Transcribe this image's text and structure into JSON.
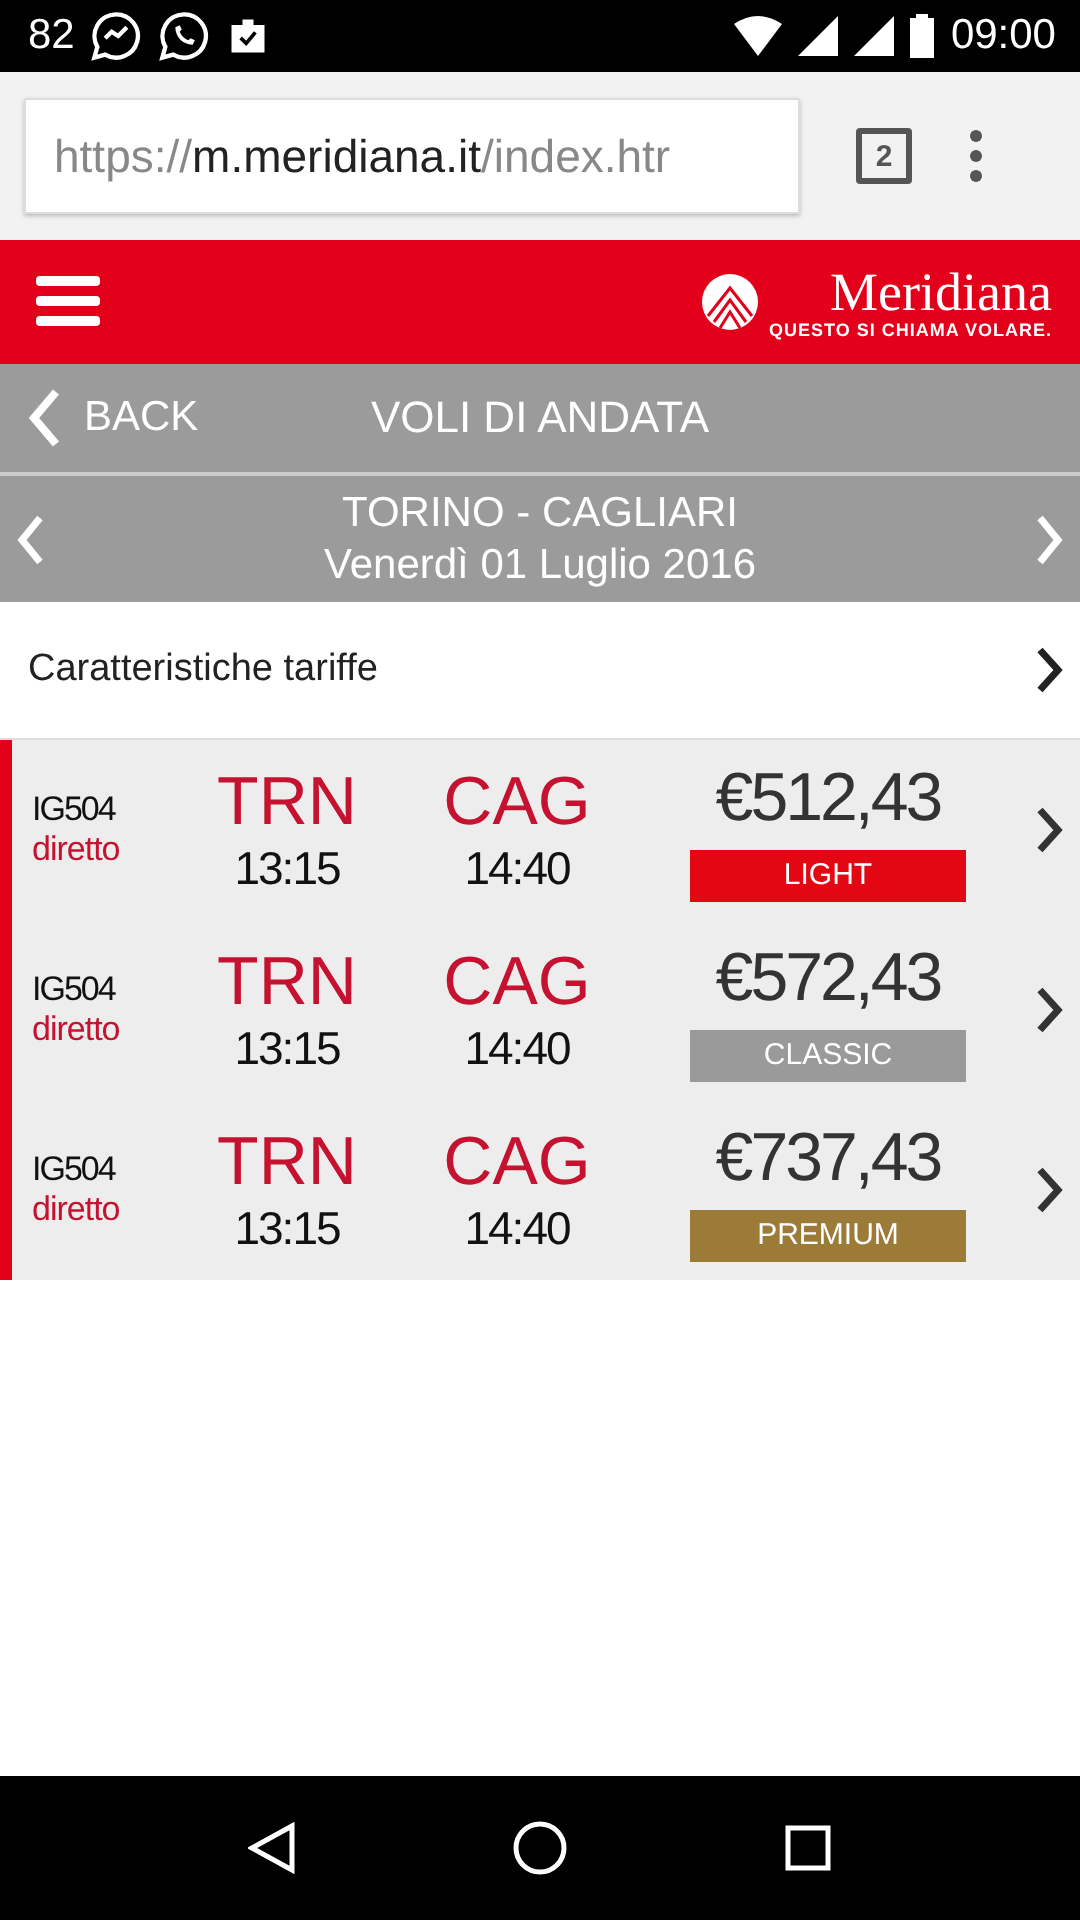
{
  "status_bar": {
    "notification_count": "82",
    "time": "09:00"
  },
  "browser": {
    "url_scheme": "https://",
    "url_host": "m.meridiana.it",
    "url_path": "/index.htr",
    "tab_count": "2"
  },
  "header": {
    "brand": "Meridiana",
    "tagline": "QUESTO SI CHIAMA VOLARE."
  },
  "nav_bar": {
    "back": "BACK",
    "title": "VOLI DI ANDATA"
  },
  "route": {
    "cities": "TORINO - CAGLIARI",
    "date": "Venerdì 01 Luglio 2016"
  },
  "fare_info": {
    "label": "Caratteristiche tariffe"
  },
  "flights": [
    {
      "code": "IG504",
      "type": "diretto",
      "from": "TRN",
      "dep": "13:15",
      "to": "CAG",
      "arr": "14:40",
      "price": "€512,43",
      "fare": "LIGHT",
      "color": "#e30613"
    },
    {
      "code": "IG504",
      "type": "diretto",
      "from": "TRN",
      "dep": "13:15",
      "to": "CAG",
      "arr": "14:40",
      "price": "€572,43",
      "fare": "CLASSIC",
      "color": "#9a9a9a"
    },
    {
      "code": "IG504",
      "type": "diretto",
      "from": "TRN",
      "dep": "13:15",
      "to": "CAG",
      "arr": "14:40",
      "price": "€737,43",
      "fare": "PREMIUM",
      "color": "#9c7a38"
    }
  ]
}
